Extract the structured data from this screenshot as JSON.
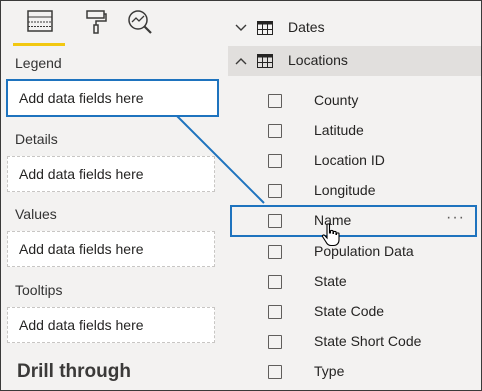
{
  "viz_tabs": {
    "icons": [
      "fields-table-icon",
      "format-paintroller-icon",
      "analytics-magnifier-icon"
    ]
  },
  "wells": [
    {
      "label": "Legend",
      "placeholder": "Add data fields here"
    },
    {
      "label": "Details",
      "placeholder": "Add data fields here"
    },
    {
      "label": "Values",
      "placeholder": "Add data fields here"
    },
    {
      "label": "Tooltips",
      "placeholder": "Add data fields here"
    }
  ],
  "drill_through": "Drill through",
  "tables": [
    {
      "name": "Dates",
      "expanded": false
    },
    {
      "name": "Locations",
      "expanded": true
    }
  ],
  "fields": [
    "County",
    "Latitude",
    "Location ID",
    "Longitude",
    "Name",
    "Population Data",
    "State",
    "State Code",
    "State Short Code",
    "Type"
  ],
  "more_options": "···",
  "colors": {
    "accent_blue": "#1e73be",
    "tab_underline": "#f2c811"
  }
}
